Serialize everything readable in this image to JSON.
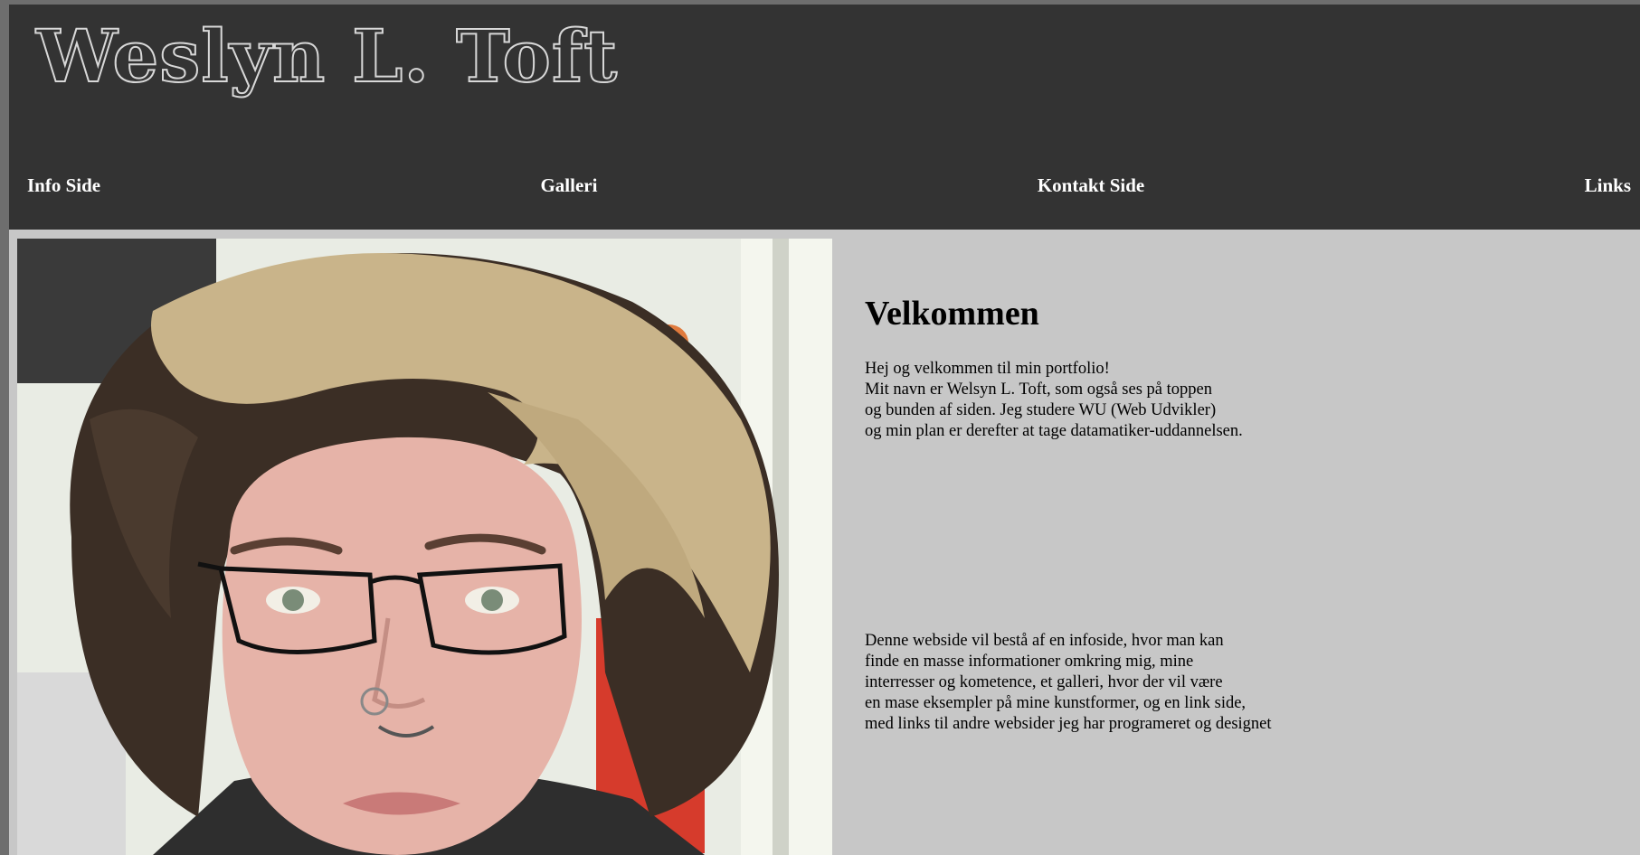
{
  "header": {
    "site_title": "Weslyn L. Toft"
  },
  "nav": {
    "items": [
      "Info Side",
      "Galleri",
      "Kontakt Side",
      "Links"
    ]
  },
  "main": {
    "heading": "Velkommen",
    "intro_lines": [
      "Hej og velkommen til min portfolio!",
      "Mit navn er Welsyn L. Toft, som også ses på toppen",
      "og bunden af siden. Jeg studere WU (Web Udvikler)",
      "og min plan er derefter at tage datamatiker-uddannelsen."
    ],
    "about_lines": [
      "Denne webside vil bestå af en infoside, hvor man kan",
      "finde en masse informationer omkring mig, mine",
      "interresser og kometence, et galleri, hvor der vil være",
      "en mase eksempler på mine kunstformer, og en link side,",
      "med links til andre websider jeg har programeret og designet"
    ]
  },
  "colors": {
    "header_bg": "#333333",
    "page_bg": "#c7c7c7",
    "outer_bg": "#6e6e6e",
    "nav_text": "#ffffff"
  }
}
